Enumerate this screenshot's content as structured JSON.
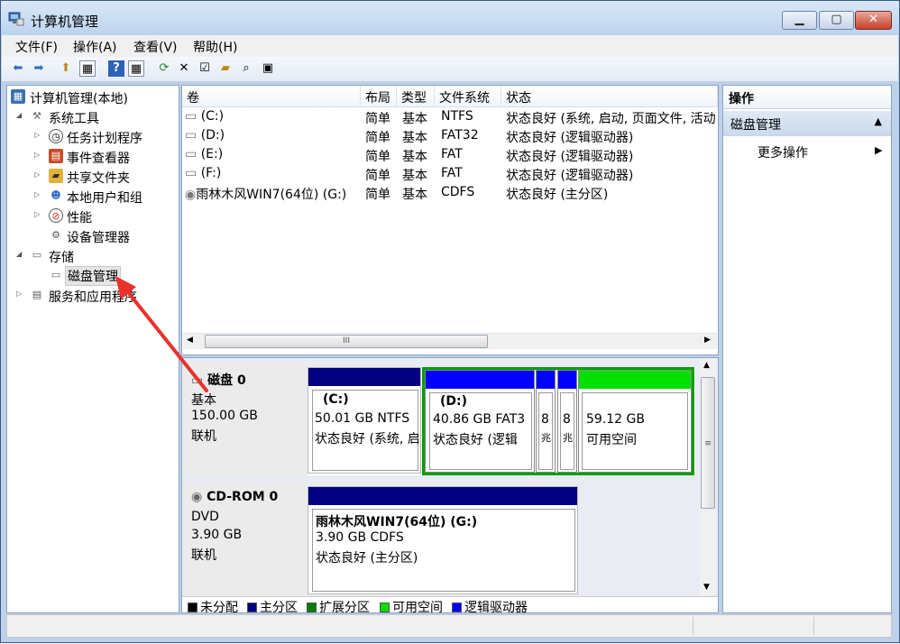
{
  "window": {
    "title": "计算机管理"
  },
  "menu": [
    "文件(F)",
    "操作(A)",
    "查看(V)",
    "帮助(H)"
  ],
  "tree": {
    "root": "计算机管理(本地)",
    "system_tools": "系统工具",
    "items": [
      "任务计划程序",
      "事件查看器",
      "共享文件夹",
      "本地用户和组",
      "性能",
      "设备管理器"
    ],
    "storage": "存储",
    "disk_management": "磁盘管理",
    "services": "服务和应用程序"
  },
  "volume_list": {
    "columns": [
      "卷",
      "布局",
      "类型",
      "文件系统",
      "状态"
    ],
    "rows": [
      {
        "volume": "(C:)",
        "layout": "简单",
        "type": "基本",
        "fs": "NTFS",
        "status": "状态良好 (系统, 启动, 页面文件, 活动"
      },
      {
        "volume": "(D:)",
        "layout": "简单",
        "type": "基本",
        "fs": "FAT32",
        "status": "状态良好 (逻辑驱动器)"
      },
      {
        "volume": "(E:)",
        "layout": "简单",
        "type": "基本",
        "fs": "FAT",
        "status": "状态良好 (逻辑驱动器)"
      },
      {
        "volume": "(F:)",
        "layout": "简单",
        "type": "基本",
        "fs": "FAT",
        "status": "状态良好 (逻辑驱动器)"
      },
      {
        "volume": "雨林木风WIN7(64位) (G:)",
        "layout": "简单",
        "type": "基本",
        "fs": "CDFS",
        "status": "状态良好 (主分区)"
      }
    ],
    "scroll_thumb": "III"
  },
  "disks": {
    "disk0": {
      "name": "磁盘 0",
      "kind": "基本",
      "size": "150.00 GB",
      "state": "联机",
      "partitions": [
        {
          "label": "(C:)",
          "size": "50.01 GB NTFS",
          "status": "状态良好 (系统, 启"
        },
        {
          "label": "(D:)",
          "size": "40.86 GB FAT3",
          "status": "状态良好 (逻辑"
        },
        {
          "label": "",
          "size": "8",
          "status": "兆"
        },
        {
          "label": "",
          "size": "8",
          "status": "兆"
        },
        {
          "label": "",
          "size": "59.12 GB",
          "status": "可用空间"
        }
      ]
    },
    "cdrom0": {
      "name": "CD-ROM 0",
      "kind": "DVD",
      "size": "3.90 GB",
      "state": "联机",
      "partition": {
        "label": "雨林木风WIN7(64位)  (G:)",
        "size": "3.90 GB CDFS",
        "status": "状态良好 (主分区)"
      }
    },
    "vscroll_grip": "≡"
  },
  "legend": [
    "未分配",
    "主分区",
    "扩展分区",
    "可用空间",
    "逻辑驱动器"
  ],
  "colors": {
    "unallocated": "#000000",
    "primary": "#000080",
    "extended": "#008000",
    "free": "#00e000",
    "logical": "#0000ff",
    "arrow": "#e8322c"
  },
  "actions": {
    "header": "操作",
    "section": "磁盘管理",
    "more": "更多操作"
  }
}
